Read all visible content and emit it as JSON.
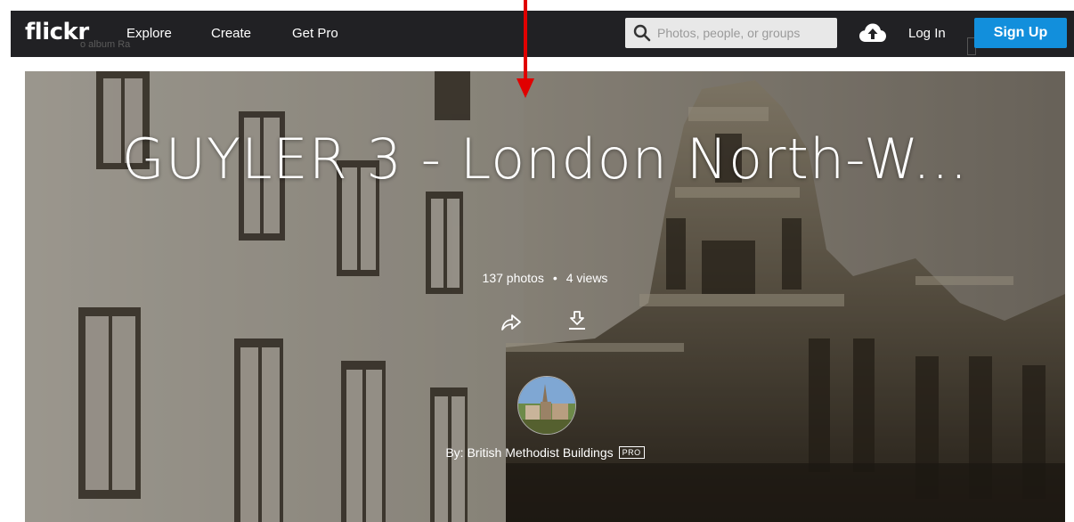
{
  "nav": {
    "logo": "flickr",
    "links": [
      "Explore",
      "Create",
      "Get Pro"
    ],
    "search_placeholder": "Photos, people, or groups",
    "login_label": "Log In",
    "signup_label": "Sign Up",
    "ghost_text": "o album Ra"
  },
  "album": {
    "title": "GUYLER 3 - London North-W...",
    "photo_count": "137 photos",
    "separator": "•",
    "views": "4 views",
    "byline": "By: British Methodist Buildings",
    "pro_badge": "PRO"
  },
  "colors": {
    "navbar": "#212124",
    "signup": "#128fdc",
    "annotation_arrow": "#e00000"
  },
  "icons": [
    "search-icon",
    "upload-cloud-icon",
    "share-icon",
    "download-icon",
    "arrow-down-icon"
  ]
}
